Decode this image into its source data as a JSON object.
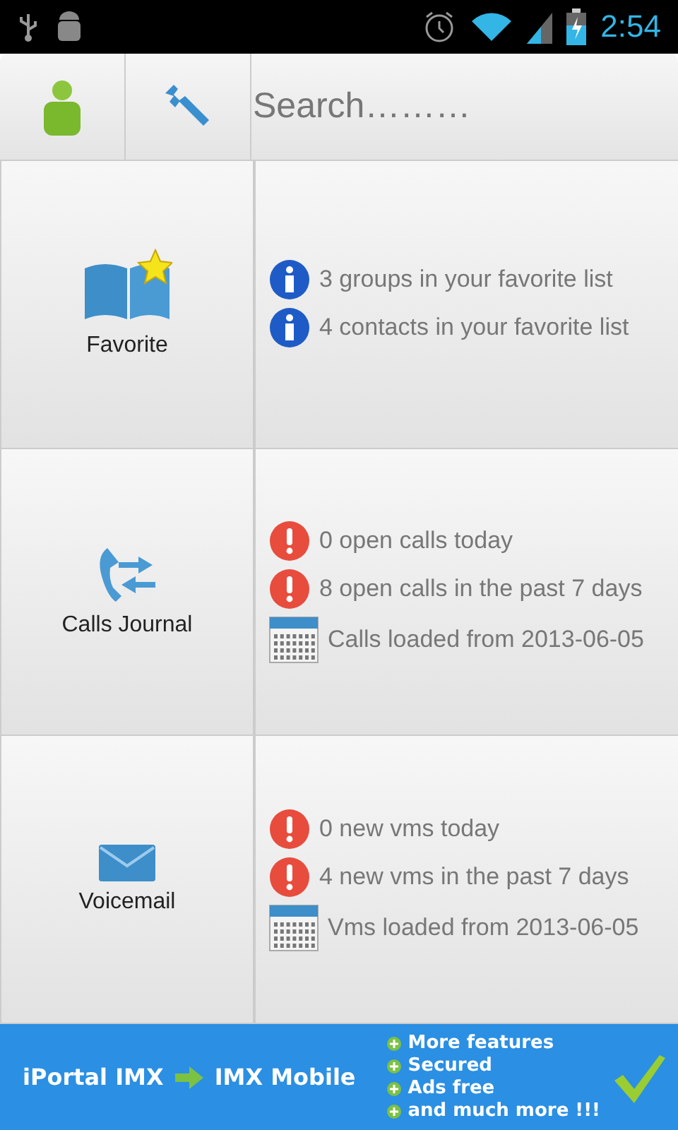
{
  "status_bar": {
    "time": "2:54"
  },
  "toolbar": {
    "search": {
      "placeholder": "Search………"
    }
  },
  "sections": [
    {
      "label": "Favorite",
      "kind": "book",
      "lines": [
        {
          "kind": "info",
          "text": "3 groups in your favorite list"
        },
        {
          "kind": "info",
          "text": "4 contacts in your favorite list"
        }
      ]
    },
    {
      "label": "Calls Journal",
      "kind": "calls",
      "lines": [
        {
          "kind": "alert",
          "text": "0 open calls today"
        },
        {
          "kind": "alert",
          "text": "8 open calls in the past 7 days"
        },
        {
          "kind": "calendar",
          "text": "Calls loaded from 2013-06-05"
        }
      ]
    },
    {
      "label": "Voicemail",
      "kind": "mail",
      "lines": [
        {
          "kind": "alert",
          "text": "0 new vms today"
        },
        {
          "kind": "alert",
          "text": "4 new vms in the past 7 days"
        },
        {
          "kind": "calendar",
          "text": "Vms loaded from 2013-06-05"
        }
      ]
    }
  ],
  "banner": {
    "from": "iPortal IMX",
    "to": "IMX Mobile",
    "features": [
      "More features",
      "Secured",
      "Ads free",
      "and much more !!!"
    ]
  }
}
